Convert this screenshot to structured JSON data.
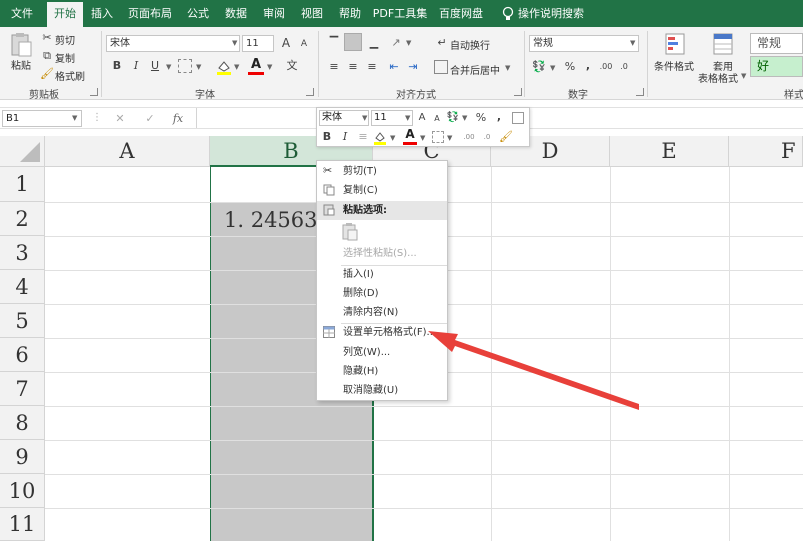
{
  "tabs": [
    "文件",
    "开始",
    "插入",
    "页面布局",
    "公式",
    "数据",
    "审阅",
    "视图",
    "帮助",
    "PDF工具集",
    "百度网盘",
    "操作说明搜索"
  ],
  "ribbon": {
    "clipboard": {
      "paste": "粘贴",
      "cut": "剪切",
      "copy": "复制",
      "format_painter": "格式刷",
      "label": "剪贴板"
    },
    "font": {
      "name": "宋体",
      "size": "11",
      "label": "字体",
      "bold": "B",
      "italic": "I",
      "underline": "U",
      "font_color_glyph": "A",
      "grow": "A",
      "shrink": "A"
    },
    "alignment": {
      "wrap_text": "自动换行",
      "merge_center": "合并后居中",
      "label": "对齐方式"
    },
    "number": {
      "format": "常规",
      "percent": "%",
      "comma": ",",
      "label": "数字"
    },
    "styles": {
      "conditional": "条件格式",
      "table_format_1": "套用",
      "table_format_2": "表格格式",
      "style_normal": "常规",
      "style_good": "好",
      "label": "样式"
    }
  },
  "formula_bar": {
    "name_box": "B1",
    "cancel": "✕",
    "enter": "✓",
    "fx": "fx",
    "value": ""
  },
  "grid": {
    "columns": [
      "A",
      "B",
      "C",
      "D",
      "E",
      "F"
    ],
    "rows": [
      "1",
      "2",
      "3",
      "4",
      "5",
      "6",
      "7",
      "8",
      "9",
      "10",
      "11"
    ],
    "cell_b2": "1. 24563"
  },
  "mini_toolbar": {
    "font": "宋体",
    "size": "11",
    "bold": "B",
    "italic": "I",
    "percent": "%",
    "comma": ",",
    "grow": "A",
    "shrink": "A",
    "font_color_glyph": "A"
  },
  "context_menu": {
    "cut": "剪切(T)",
    "copy": "复制(C)",
    "paste_options": "粘贴选项:",
    "paste_special": "选择性粘贴(S)...",
    "insert": "插入(I)",
    "delete": "删除(D)",
    "clear_contents": "清除内容(N)",
    "format_cells": "设置单元格格式(F)...",
    "column_width": "列宽(W)...",
    "hide": "隐藏(H)",
    "unhide": "取消隐藏(U)"
  },
  "colors": {
    "excel_green": "#217346",
    "selection_fill": "#c8c8c8",
    "annotation_arrow": "#e8403a"
  }
}
